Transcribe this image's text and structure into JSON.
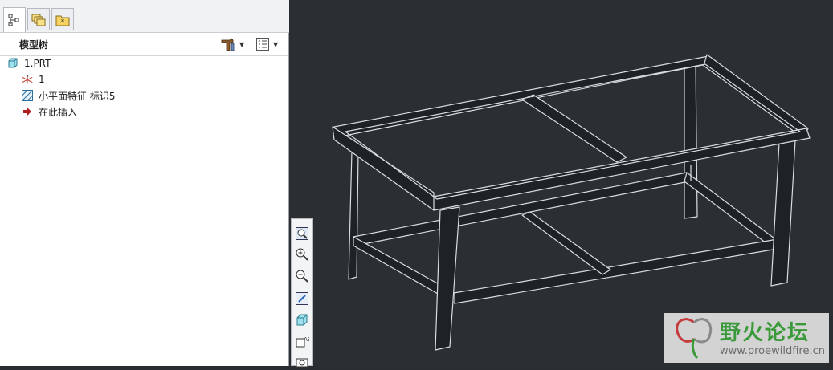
{
  "panel": {
    "tabs": [
      {
        "icon": "model-tree-tab-icon"
      },
      {
        "icon": "layers-tab-icon"
      },
      {
        "icon": "folder-browser-tab-icon"
      }
    ],
    "title": "模型树",
    "settings_icon": "tree-settings-icon",
    "columns_icon": "tree-columns-icon"
  },
  "tree": {
    "items": [
      {
        "label": "1.PRT",
        "icon": "part-icon"
      },
      {
        "label": "1",
        "icon": "csys-icon"
      },
      {
        "label": "小平面特征 标识5",
        "icon": "facet-feature-icon"
      },
      {
        "label": "在此插入",
        "icon": "insert-here-arrow-icon"
      }
    ]
  },
  "view_toolbar": {
    "buttons": [
      {
        "icon": "refit-zoom-icon"
      },
      {
        "icon": "zoom-in-icon"
      },
      {
        "icon": "zoom-out-icon"
      },
      {
        "icon": "repaint-icon"
      },
      {
        "icon": "shading-style-icon"
      },
      {
        "icon": "saved-views-icon"
      },
      {
        "icon": "view-manager-icon"
      }
    ]
  },
  "watermark": {
    "title": "野火论坛",
    "url": "www.proewildfire.cn"
  },
  "colors": {
    "viewport_bg": "#2c2f31",
    "frame_fill": "#1f2224",
    "frame_edge": "#d9dde0",
    "watermark_green": "#3a9a3a"
  }
}
